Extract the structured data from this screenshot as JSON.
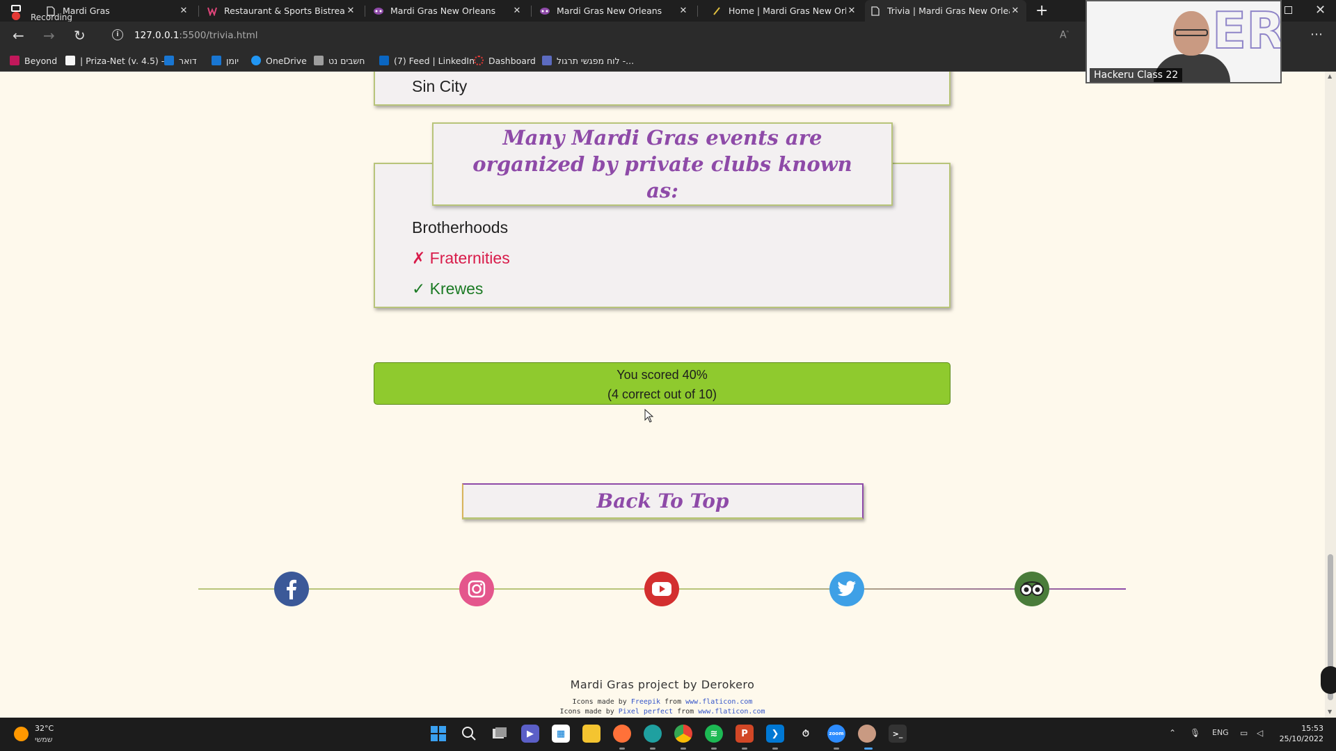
{
  "browser": {
    "recording_label": "Recording",
    "tabs": [
      {
        "title": "Mardi Gras",
        "active": false
      },
      {
        "title": "Restaurant & Sports Bistreaux | \\",
        "active": false
      },
      {
        "title": "Mardi Gras New Orleans",
        "active": false
      },
      {
        "title": "Mardi Gras New Orleans",
        "active": false
      },
      {
        "title": "Home | Mardi Gras New Orleans",
        "active": false
      },
      {
        "title": "Trivia | Mardi Gras New Orleans",
        "active": true
      }
    ],
    "url_host": "127.0.0.1",
    "url_rest": ":5500/trivia.html",
    "bookmarks": [
      {
        "label": "Beyond",
        "icon_color": "#c2185b"
      },
      {
        "label": "| Priza-Net (v. 4.5) -",
        "icon_color": "#f5f5f5"
      },
      {
        "label": "דואר",
        "icon_color": "#1976d2"
      },
      {
        "label": "יומן",
        "icon_color": "#1976d2"
      },
      {
        "label": "OneDrive",
        "icon_color": "#2196f3"
      },
      {
        "label": "חשבים נט",
        "icon_color": "#9e9e9e"
      },
      {
        "label": "(7) Feed | LinkedIn",
        "icon_color": "#0a66c2"
      },
      {
        "label": "Dashboard",
        "icon_color": "#e53935"
      },
      {
        "label": "לוח מפגשי תרגול -...",
        "icon_color": "#5c6bc0"
      }
    ]
  },
  "video": {
    "participant": "Hackeru Class 22"
  },
  "page": {
    "prev_answer": "Sin City",
    "question": "Many Mardi Gras events are organized by private clubs known as:",
    "answers": [
      {
        "text": "Brotherhoods",
        "state": "neutral",
        "mark": ""
      },
      {
        "text": "Fraternities",
        "state": "wrong",
        "mark": "✗"
      },
      {
        "text": "Krewes",
        "state": "right",
        "mark": "✓"
      }
    ],
    "score_line1": "You scored 40%",
    "score_line2": "(4 correct out of 10)",
    "back_to_top": "Back To Top",
    "social": [
      {
        "name": "facebook",
        "color": "#3b5998"
      },
      {
        "name": "instagram",
        "color": "#e4568c"
      },
      {
        "name": "youtube",
        "color": "#d32f2f"
      },
      {
        "name": "twitter",
        "color": "#3ea0e6"
      },
      {
        "name": "tripadvisor",
        "color": "#4a7c3a"
      }
    ],
    "footer": "Mardi Gras project by Derokero",
    "credit1": {
      "pre": "Icons made by ",
      "author": "Freepik",
      "mid": " from ",
      "site": "www.flaticon.com"
    },
    "credit2": {
      "pre": "Icons made by ",
      "author": "Pixel perfect",
      "mid": " from ",
      "site": "www.flaticon.com"
    }
  },
  "taskbar": {
    "temperature": "32°C",
    "weather": "שמשי",
    "lang": "ENG",
    "time": "15:53",
    "date": "25/10/2022"
  }
}
